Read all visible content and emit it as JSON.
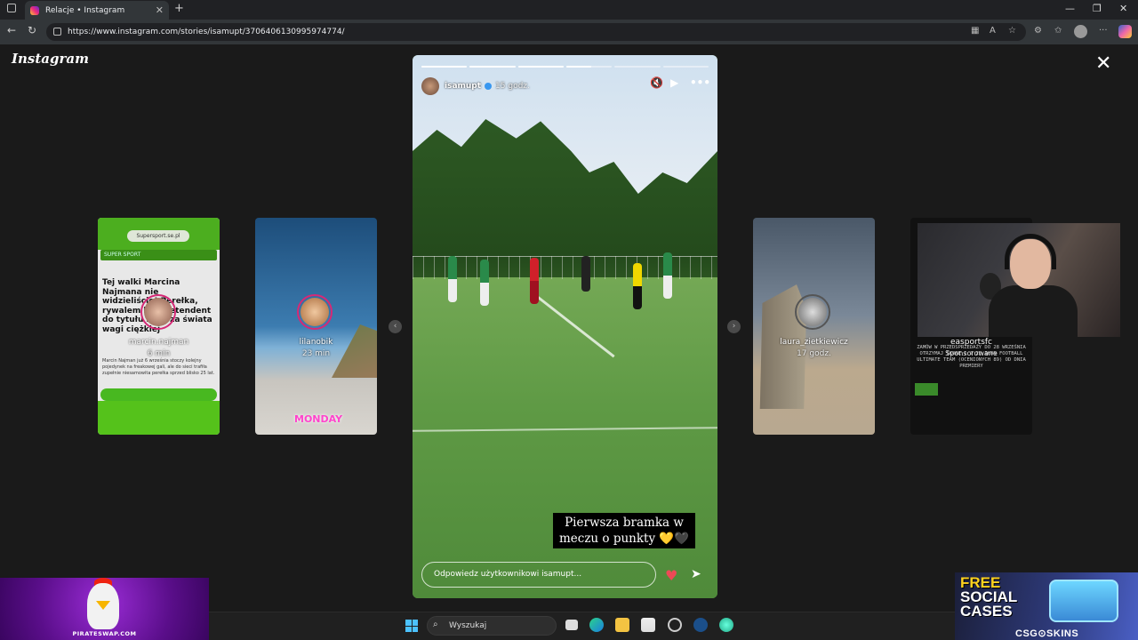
{
  "browser": {
    "tab_title": "Relacje • Instagram",
    "url": "https://www.instagram.com/stories/isamupt/3706406130995974774/"
  },
  "instagram": {
    "logo": "Instagram"
  },
  "cards": [
    {
      "username": "marcin.najman",
      "time": "6 min",
      "pill": "Supersport.se.pl",
      "bar": "SUPER SPORT",
      "headline": "Tej walki Marcina Najmana nie widzieliście! Perełka, rywalem był pretendent do tytułu mistrza świata wagi ciężkiej",
      "body": "Marcin Najman już 6 września stoczy kolejny pojedynek na freakowej gali, ale do sieci trafiła zupełnie niesamowita perełka sprzed blisko 25 lat."
    },
    {
      "username": "lilanobik",
      "time": "23 min",
      "tag": "MONDAY"
    },
    {
      "username": "laura_zietkiewicz",
      "time": "17 godz."
    },
    {
      "username": "easportsfc",
      "sponsored": "Sponsorowane",
      "promo": "ZAMÓW W PRZEDSPRZEDAŻY DO 28 WRZEŚNIA OTRZYMAJ IKONĘ 1 Z 25 IKON FOOTBALL ULTIMATE TEAM (OCENIONYCH 89) OD DNIA PREMIERY"
    }
  ],
  "story": {
    "username": "isamupt",
    "time": "15 godz.",
    "caption": "Pierwsza bramka w meczu o punkty 💛🖤",
    "reply_placeholder": "Odpowiedz użytkownikowi isamupt...",
    "progress": [
      1,
      1,
      1,
      0.55,
      0,
      0
    ]
  },
  "overlays": {
    "pirate_brand": "PIRATESWAP.COM",
    "csgo_line1": "FREE",
    "csgo_line2": "SOCIAL",
    "csgo_line3": "CASES",
    "csgo_brand": "CSG⊙SKINS"
  },
  "taskbar": {
    "search_label": "Wyszukaj"
  },
  "colors": {
    "story_bg": "#1a1a1a",
    "verified": "#3897f0",
    "heart": "#ed4956",
    "card1_green": "#4cae1f"
  }
}
